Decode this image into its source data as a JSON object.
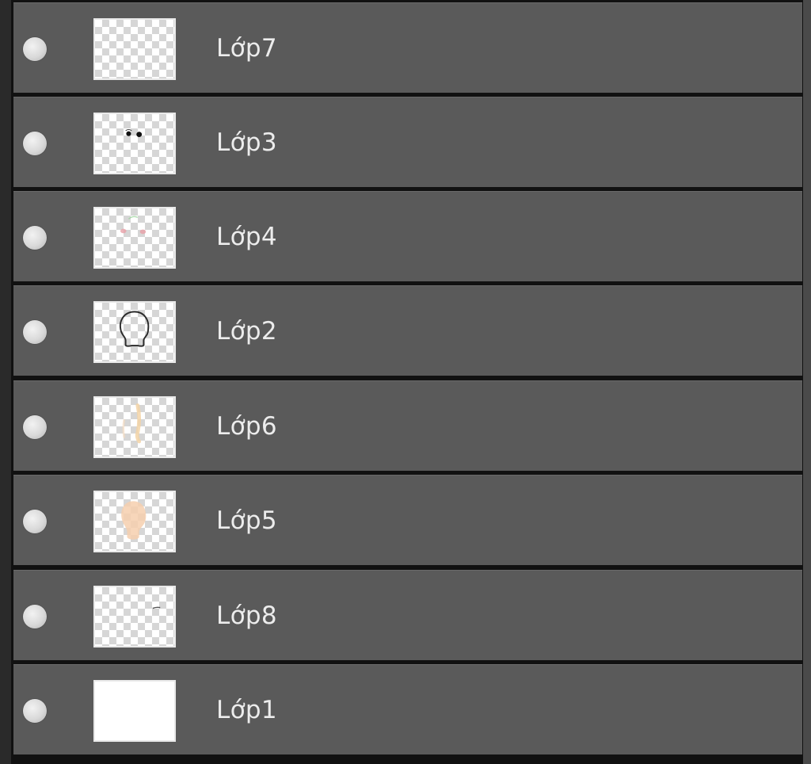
{
  "panel": {
    "title": "",
    "layers": [
      {
        "name": "Lớp7",
        "visible": true,
        "thumbnail": "empty-transparent"
      },
      {
        "name": "Lớp3",
        "visible": true,
        "thumbnail": "eyes-sketch"
      },
      {
        "name": "Lớp4",
        "visible": true,
        "thumbnail": "blush-marks"
      },
      {
        "name": "Lớp2",
        "visible": true,
        "thumbnail": "head-outline"
      },
      {
        "name": "Lớp6",
        "visible": true,
        "thumbnail": "hair-strands"
      },
      {
        "name": "Lớp5",
        "visible": true,
        "thumbnail": "skin-fill"
      },
      {
        "name": "Lớp8",
        "visible": true,
        "thumbnail": "small-mark"
      },
      {
        "name": "Lớp1",
        "visible": true,
        "thumbnail": "white-background"
      }
    ]
  },
  "colors": {
    "row_background": "#5a5a5a",
    "row_separator": "#111111",
    "label_text": "#ececec",
    "visibility_dot": "#d9d9d9",
    "skin_tone": "#f6cfae",
    "blush": "#e8a0a8"
  }
}
